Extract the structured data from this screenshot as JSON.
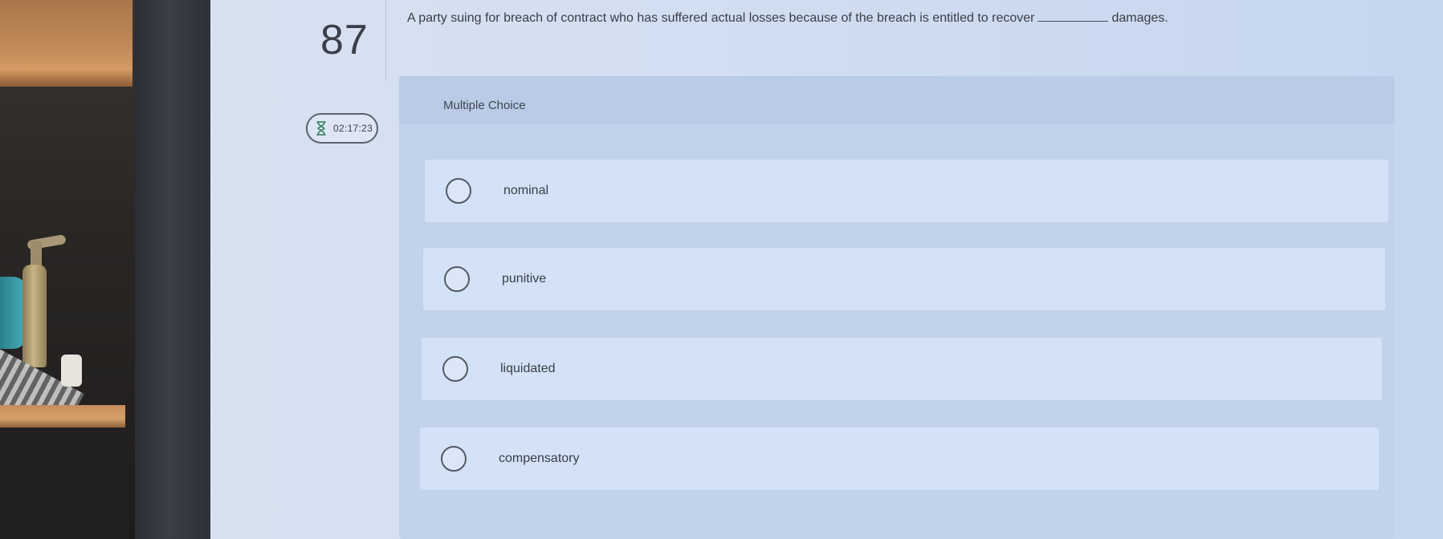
{
  "question": {
    "number": "87",
    "text_before_blank": "A party suing for breach of contract who has suffered actual losses because of the breach is entitled to recover",
    "text_after_blank": "damages."
  },
  "timer": {
    "icon": "hourglass-icon",
    "value": "02:17:23"
  },
  "answer_panel": {
    "type_label": "Multiple Choice",
    "options": [
      {
        "label": "nominal",
        "selected": false
      },
      {
        "label": "punitive",
        "selected": false
      },
      {
        "label": "liquidated",
        "selected": false
      },
      {
        "label": "compensatory",
        "selected": false
      }
    ]
  },
  "colors": {
    "screen_background": "#d2def1",
    "panel_background": "#c2d2ea",
    "option_background": "#d3e2f6",
    "text": "#3a3e48"
  }
}
